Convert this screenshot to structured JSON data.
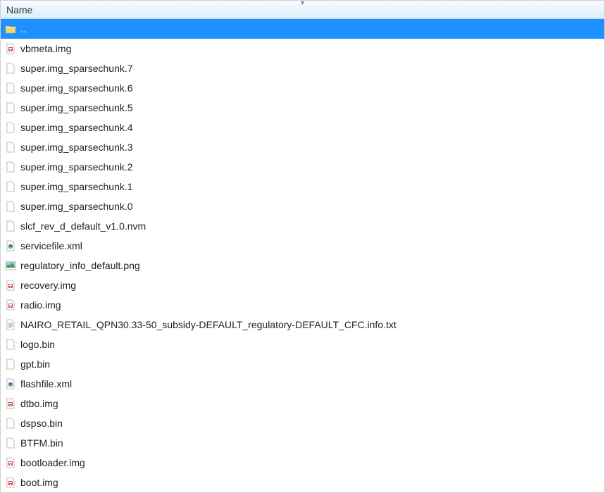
{
  "header": {
    "column_name": "Name"
  },
  "files": [
    {
      "name": "..",
      "icon": "folder-up",
      "selected": true
    },
    {
      "name": "vbmeta.img",
      "icon": "disk-image",
      "selected": false
    },
    {
      "name": "super.img_sparsechunk.7",
      "icon": "blank-file",
      "selected": false
    },
    {
      "name": "super.img_sparsechunk.6",
      "icon": "blank-file",
      "selected": false
    },
    {
      "name": "super.img_sparsechunk.5",
      "icon": "blank-file",
      "selected": false
    },
    {
      "name": "super.img_sparsechunk.4",
      "icon": "blank-file",
      "selected": false
    },
    {
      "name": "super.img_sparsechunk.3",
      "icon": "blank-file",
      "selected": false
    },
    {
      "name": "super.img_sparsechunk.2",
      "icon": "blank-file",
      "selected": false
    },
    {
      "name": "super.img_sparsechunk.1",
      "icon": "blank-file",
      "selected": false
    },
    {
      "name": "super.img_sparsechunk.0",
      "icon": "blank-file",
      "selected": false
    },
    {
      "name": "slcf_rev_d_default_v1.0.nvm",
      "icon": "blank-file",
      "selected": false
    },
    {
      "name": "servicefile.xml",
      "icon": "xml-file",
      "selected": false
    },
    {
      "name": "regulatory_info_default.png",
      "icon": "image-file",
      "selected": false
    },
    {
      "name": "recovery.img",
      "icon": "disk-image",
      "selected": false
    },
    {
      "name": "radio.img",
      "icon": "disk-image",
      "selected": false
    },
    {
      "name": "NAIRO_RETAIL_QPN30.33-50_subsidy-DEFAULT_regulatory-DEFAULT_CFC.info.txt",
      "icon": "text-file",
      "selected": false
    },
    {
      "name": "logo.bin",
      "icon": "blank-file",
      "selected": false
    },
    {
      "name": "gpt.bin",
      "icon": "blank-file",
      "selected": false
    },
    {
      "name": "flashfile.xml",
      "icon": "xml-file",
      "selected": false
    },
    {
      "name": "dtbo.img",
      "icon": "disk-image",
      "selected": false
    },
    {
      "name": "dspso.bin",
      "icon": "blank-file",
      "selected": false
    },
    {
      "name": "BTFM.bin",
      "icon": "blank-file",
      "selected": false
    },
    {
      "name": "bootloader.img",
      "icon": "disk-image",
      "selected": false
    },
    {
      "name": "boot.img",
      "icon": "disk-image",
      "selected": false
    }
  ]
}
